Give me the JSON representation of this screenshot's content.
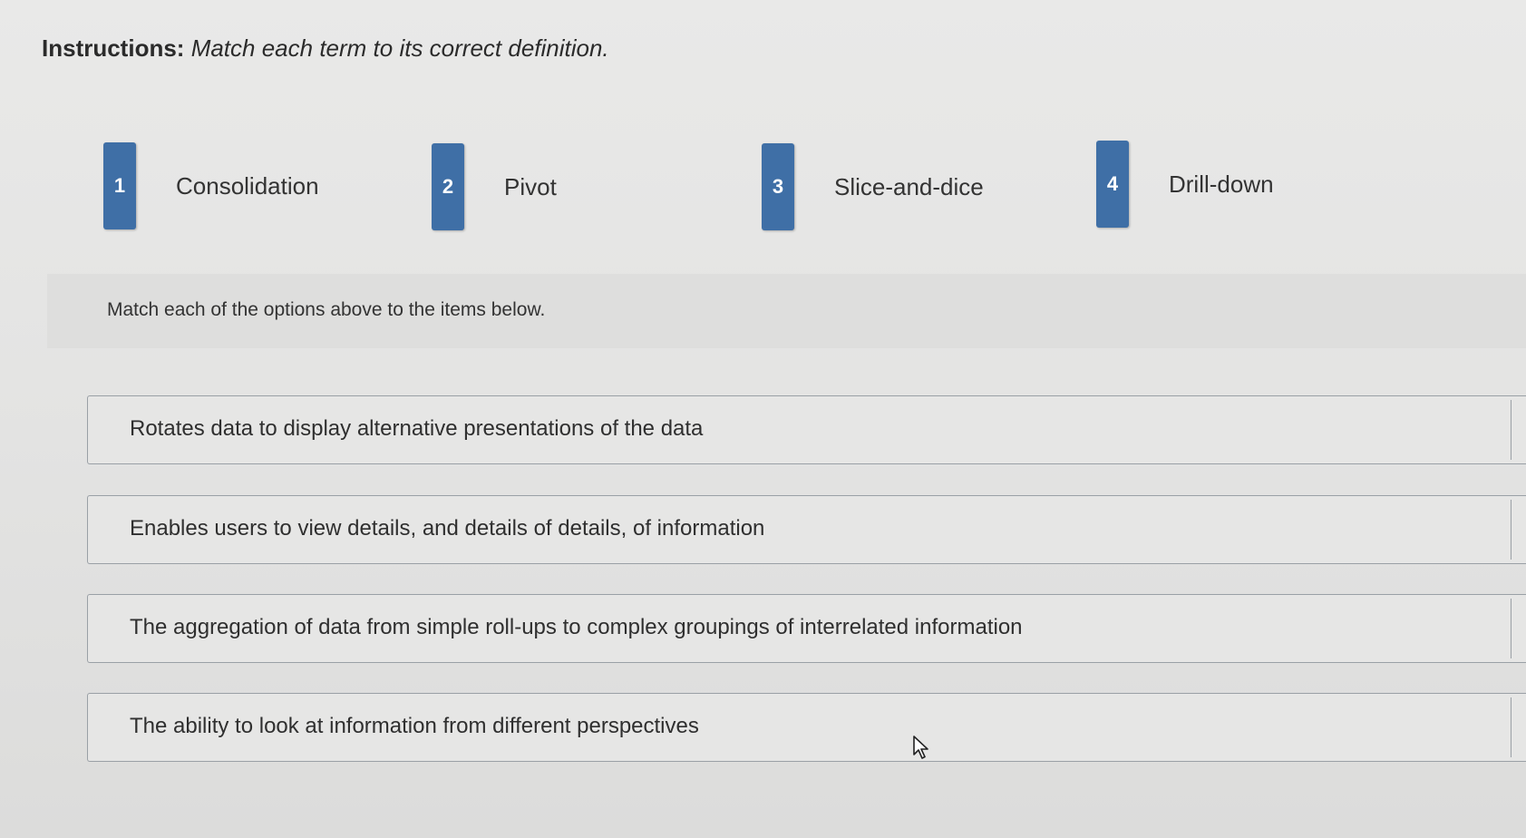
{
  "instructions": {
    "label": "Instructions:",
    "text": "Match each term to its correct definition."
  },
  "options": [
    {
      "number": "1",
      "term": "Consolidation"
    },
    {
      "number": "2",
      "term": "Pivot"
    },
    {
      "number": "3",
      "term": "Slice-and-dice"
    },
    {
      "number": "4",
      "term": "Drill-down"
    }
  ],
  "prompt": "Match each of the options above to the items below.",
  "items": [
    {
      "definition": "Rotates data to display alternative presentations of the data"
    },
    {
      "definition": "Enables users to view details, and details of details, of information"
    },
    {
      "definition": "The aggregation of data from simple roll-ups to complex groupings of interrelated information"
    },
    {
      "definition": "The ability to look at information from different perspectives"
    }
  ],
  "colors": {
    "badge": "#3f6fa6",
    "background": "#e6e6e5",
    "border": "#9aa0a6"
  },
  "icons": {
    "cursor": "mouse-pointer-icon"
  }
}
